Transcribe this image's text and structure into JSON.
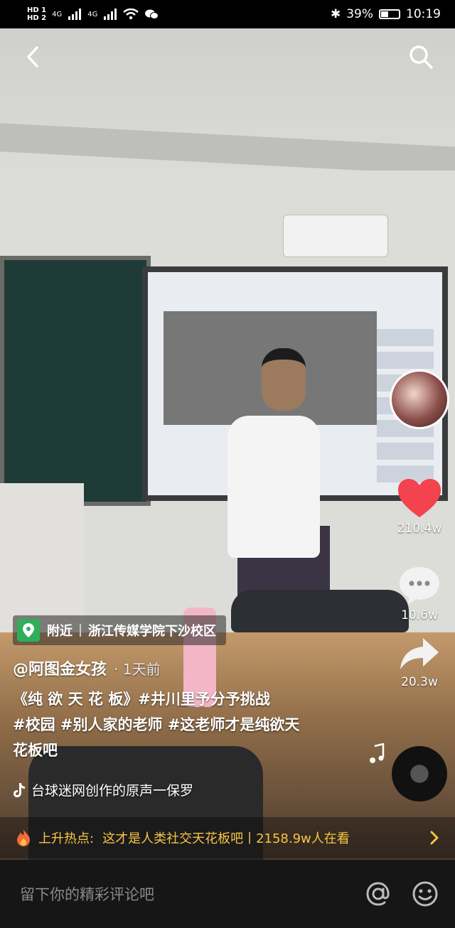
{
  "status_bar": {
    "sim1": "HD 1",
    "sim2": "HD 2",
    "network": "4G",
    "battery": "39%",
    "battery_level": 0.39,
    "time": "10:19"
  },
  "nav": {
    "back_icon": "chevron-left-icon",
    "search_icon": "search-icon"
  },
  "actions": {
    "likes": "210.4w",
    "comments": "10.6w",
    "shares": "20.3w"
  },
  "location": {
    "label": "附近",
    "place": "浙江传媒学院下沙校区"
  },
  "post": {
    "author": "@阿图金女孩",
    "time": "· 1天前",
    "caption_line1": "《纯 欲 天 花 板》#井川里予分予挑战",
    "caption_line2": "#校园 #别人家的老师 #这老师才是纯欲天",
    "caption_line3": "花板吧",
    "music": "台球迷网创作的原声一保罗"
  },
  "hot": {
    "label": "上升热点:",
    "text": "这才是人类社交天花板吧丨2158.9w人在看"
  },
  "comment": {
    "placeholder": "留下你的精彩评论吧"
  },
  "colors": {
    "like": "#f2434f",
    "hot": "#f7c544",
    "location_pin": "#2fae5b"
  }
}
